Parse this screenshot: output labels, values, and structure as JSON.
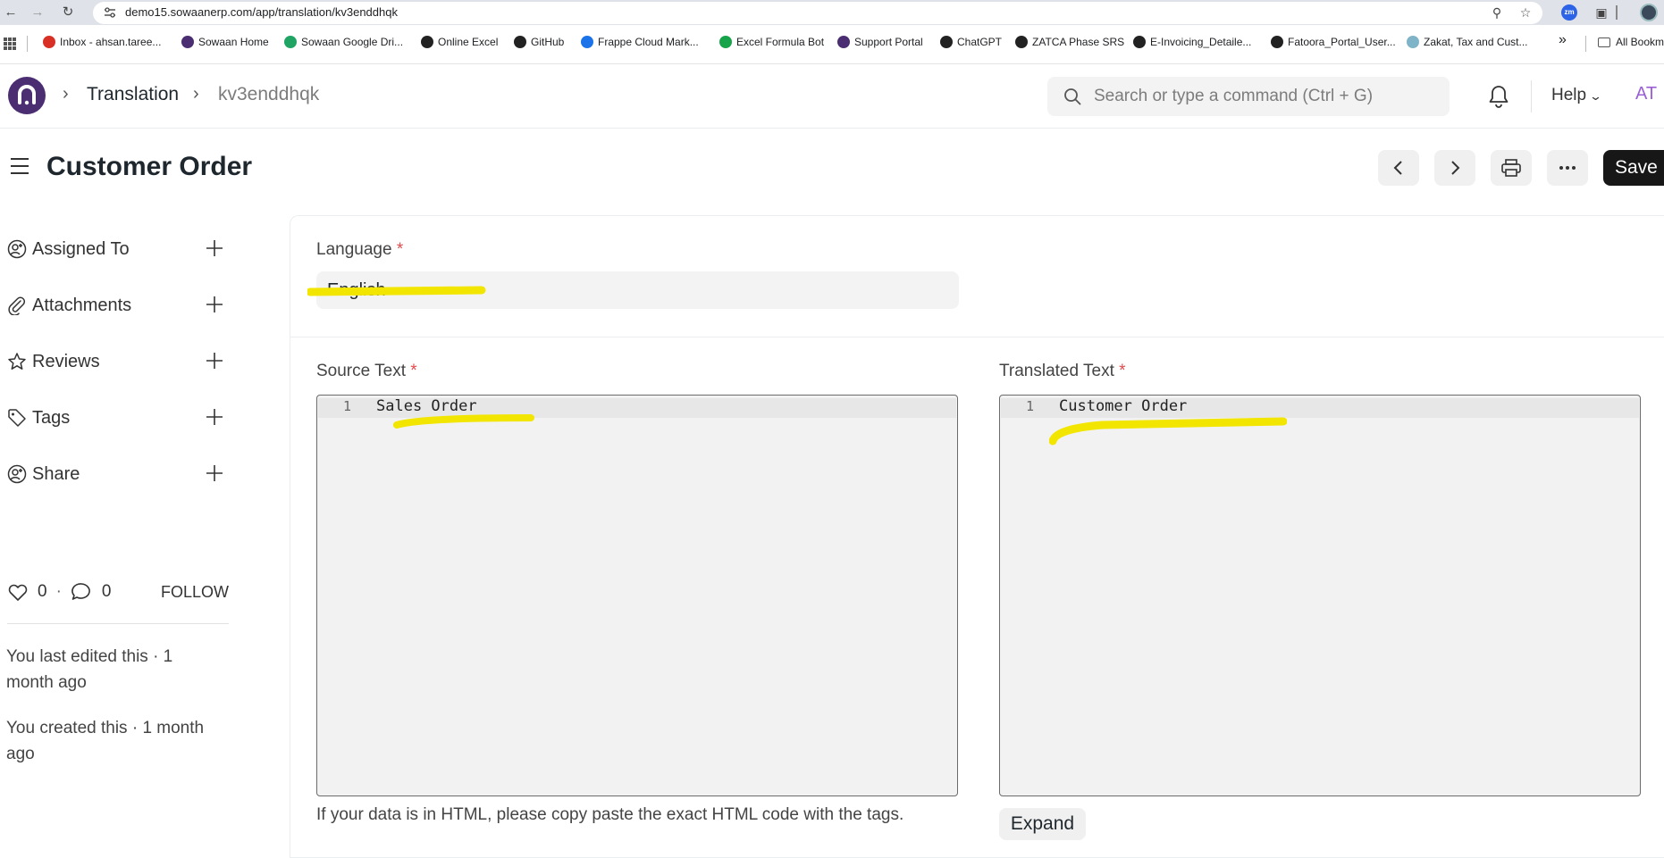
{
  "browser": {
    "url": "demo15.sowaanerp.com/app/translation/kv3enddhqk",
    "bookmarks": [
      {
        "label": "Inbox - ahsan.taree...",
        "color": "#d93025"
      },
      {
        "label": "Sowaan Home",
        "color": "#4b2d72"
      },
      {
        "label": "Sowaan Google Dri...",
        "color": "#1fa463"
      },
      {
        "label": "Online Excel",
        "color": "#222222"
      },
      {
        "label": "GitHub",
        "color": "#222222"
      },
      {
        "label": "Frappe Cloud Mark...",
        "color": "#1a73e8"
      },
      {
        "label": "Excel Formula Bot",
        "color": "#16a34a"
      },
      {
        "label": "Support Portal",
        "color": "#4b2d72"
      },
      {
        "label": "ChatGPT",
        "color": "#222222"
      },
      {
        "label": "ZATCA Phase SRS",
        "color": "#222222"
      },
      {
        "label": "E-Invoicing_Detaile...",
        "color": "#222222"
      },
      {
        "label": "Fatoora_Portal_User...",
        "color": "#222222"
      },
      {
        "label": "Zakat, Tax and Cust...",
        "color": "#7fb3c8"
      }
    ],
    "overflow_label": "»",
    "all_bookmarks_label": "All Bookm"
  },
  "header": {
    "breadcrumbs": [
      "Translation",
      "kv3enddhqk"
    ],
    "search_placeholder": "Search or type a command (Ctrl + G)",
    "help_label": "Help",
    "avatar_initials": "AT"
  },
  "page": {
    "title": "Customer Order",
    "save_label": "Save"
  },
  "sidebar": {
    "items": [
      {
        "label": "Assigned To"
      },
      {
        "label": "Attachments"
      },
      {
        "label": "Reviews"
      },
      {
        "label": "Tags"
      },
      {
        "label": "Share"
      }
    ],
    "likes_count": "0",
    "separator": "·",
    "comments_count": "0",
    "follow_label": "FOLLOW",
    "last_edited": "You last edited this · 1 month ago",
    "created": "You created this · 1 month ago"
  },
  "form": {
    "language_label": "Language",
    "required_mark": "*",
    "language_value": "English",
    "source_label": "Source Text",
    "source_line_no": "1",
    "source_text": "Sales Order",
    "translated_label": "Translated Text",
    "translated_line_no": "1",
    "translated_text": "Customer Order",
    "html_help": "If your data is in HTML, please copy paste the exact HTML code with the tags.",
    "expand_label": "Expand"
  },
  "colors": {
    "brand": "#4b2d72",
    "highlight": "#f2e600",
    "required": "#e24c4c",
    "primary_button": "#171717"
  }
}
